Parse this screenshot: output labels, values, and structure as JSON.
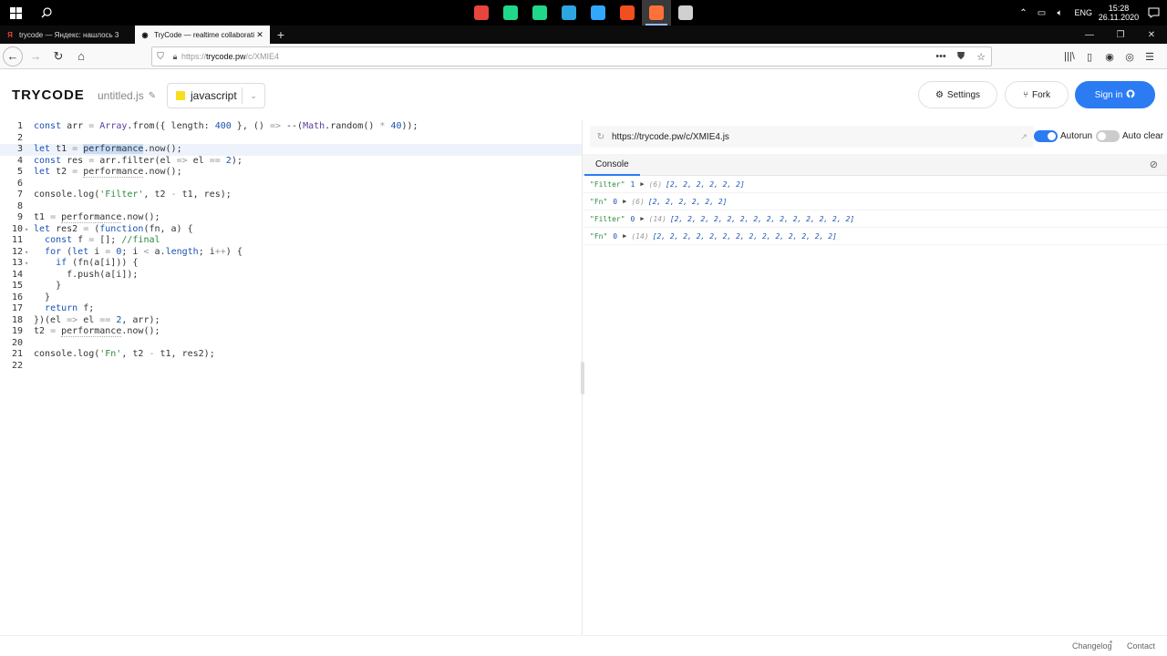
{
  "taskbar": {
    "apps": [
      {
        "name": "chrome-icon",
        "color": "#e8453c",
        "active": false
      },
      {
        "name": "webstorm-icon",
        "color": "#21d789",
        "active": false
      },
      {
        "name": "pycharm-icon",
        "color": "#21d789",
        "active": false
      },
      {
        "name": "telegram-icon",
        "color": "#2ca5e0",
        "active": false
      },
      {
        "name": "photoshop-icon",
        "color": "#31a8ff",
        "active": false
      },
      {
        "name": "figma-icon",
        "color": "#f24e1e",
        "active": false
      },
      {
        "name": "firefox-icon",
        "color": "#ff7139",
        "active": true
      },
      {
        "name": "remote-desktop-icon",
        "color": "#d0d0d0",
        "active": false
      }
    ],
    "lang": "ENG",
    "time": "15:28",
    "date": "26.11.2020"
  },
  "browser": {
    "tabs": [
      {
        "title": "trycode — Яндекс: нашлось 3",
        "favicon": "Я",
        "active": false
      },
      {
        "title": "TryCode — realtime collaborati",
        "favicon": "◉",
        "active": true
      }
    ],
    "url_prefix": "https://",
    "url_host": "trycode.pw",
    "url_path": "/c/XMIE4"
  },
  "app": {
    "logo": "TRYCODE",
    "filename": "untitled.js",
    "language": "javascript",
    "settings_label": "Settings",
    "fork_label": "Fork",
    "signin_label": "Sign in"
  },
  "preview": {
    "url": "https://trycode.pw/c/XMIE4.js",
    "autorun_label": "Autorun",
    "autoclear_label": "Auto clear",
    "autorun_on": true,
    "autoclear_on": false,
    "console_tab": "Console",
    "console": [
      {
        "label": "\"Filter\"",
        "num": "1",
        "len": "(6)",
        "arr": "[2, 2, 2, 2, 2, 2]"
      },
      {
        "label": "\"Fn\"",
        "num": "0",
        "len": "(6)",
        "arr": "[2, 2, 2, 2, 2, 2]"
      },
      {
        "label": "\"Filter\"",
        "num": "0",
        "len": "(14)",
        "arr": "[2, 2, 2, 2, 2, 2, 2, 2, 2, 2, 2, 2, 2, 2]"
      },
      {
        "label": "\"Fn\"",
        "num": "0",
        "len": "(14)",
        "arr": "[2, 2, 2, 2, 2, 2, 2, 2, 2, 2, 2, 2, 2, 2]"
      }
    ]
  },
  "footer": {
    "changelog": "Changelog",
    "contact": "Contact"
  }
}
